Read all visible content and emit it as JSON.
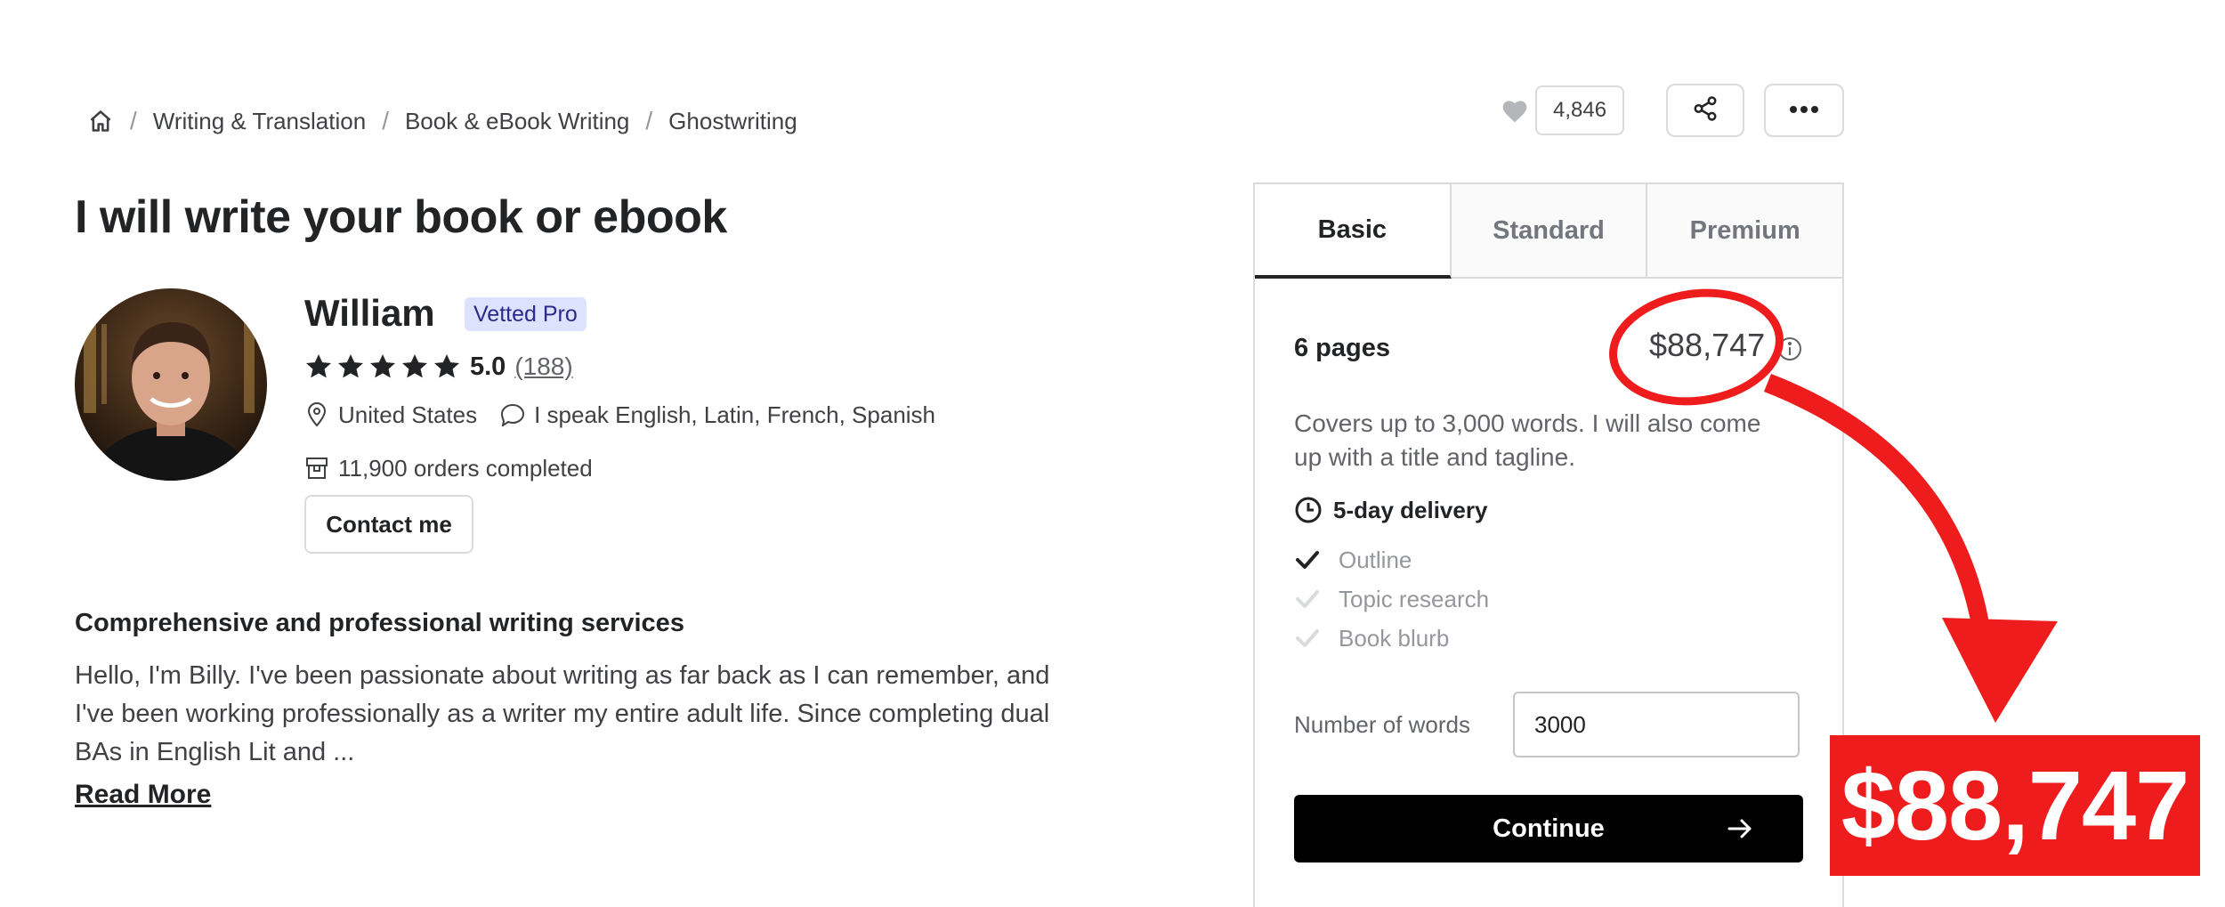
{
  "breadcrumb": {
    "items": [
      "Writing & Translation",
      "Book & eBook Writing",
      "Ghostwriting"
    ]
  },
  "actions": {
    "like_count": "4,846"
  },
  "gig": {
    "title": "I will write your book or ebook"
  },
  "seller": {
    "name": "William",
    "badge": "Vetted Pro",
    "rating": "5.0",
    "rating_count": "(188)",
    "stars": 5,
    "country": "United States",
    "languages": "I speak English, Latin, French, Spanish",
    "orders": "11,900 orders completed",
    "contact_label": "Contact me"
  },
  "description": {
    "title": "Comprehensive and professional writing services",
    "text": "Hello, I'm Billy. I've been passionate about writing as far back as I can remember, and I've been working professionally as a writer my entire adult life. Since completing dual BAs in English Lit and ...",
    "read_more": "Read More"
  },
  "package": {
    "tabs": [
      "Basic",
      "Standard",
      "Premium"
    ],
    "active_tab": "Basic",
    "name": "6 pages",
    "price": "$88,747",
    "description": "Covers up to 3,000 words. I will also come up with a title and tagline.",
    "delivery": "5-day delivery",
    "features": [
      {
        "label": "Outline",
        "included": true
      },
      {
        "label": "Topic research",
        "included": false
      },
      {
        "label": "Book blurb",
        "included": false
      }
    ],
    "words_label": "Number of words",
    "words_value": "3000",
    "continue_label": "Continue"
  },
  "annotation": {
    "callout_text": "$88,747",
    "color": "#ee1c1c"
  }
}
